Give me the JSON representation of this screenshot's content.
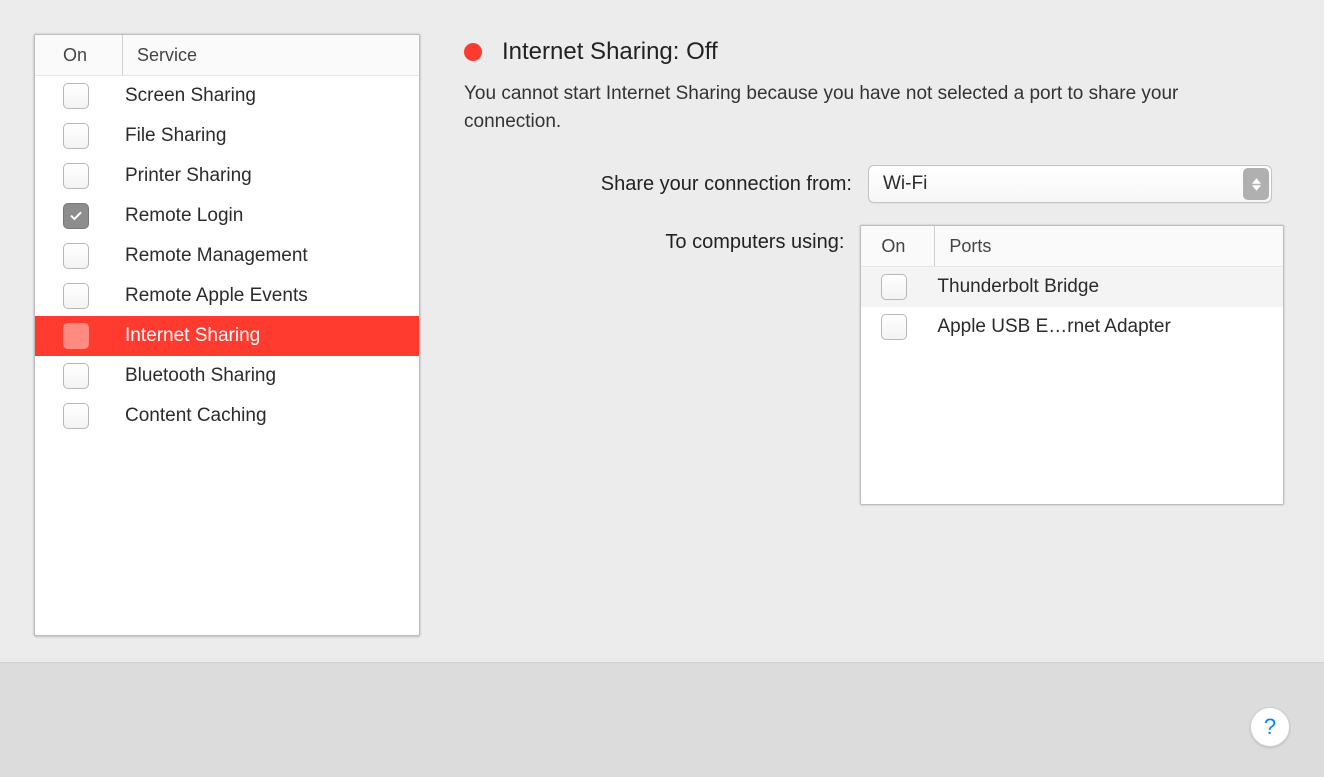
{
  "service_list": {
    "header": {
      "on": "On",
      "service": "Service"
    },
    "items": [
      {
        "label": "Screen Sharing",
        "checked": false,
        "selected": false
      },
      {
        "label": "File Sharing",
        "checked": false,
        "selected": false
      },
      {
        "label": "Printer Sharing",
        "checked": false,
        "selected": false
      },
      {
        "label": "Remote Login",
        "checked": true,
        "selected": false
      },
      {
        "label": "Remote Management",
        "checked": false,
        "selected": false
      },
      {
        "label": "Remote Apple Events",
        "checked": false,
        "selected": false
      },
      {
        "label": "Internet Sharing",
        "checked": false,
        "selected": true
      },
      {
        "label": "Bluetooth Sharing",
        "checked": false,
        "selected": false
      },
      {
        "label": "Content Caching",
        "checked": false,
        "selected": false
      }
    ]
  },
  "status": {
    "color": "#ff3b30",
    "title": "Internet Sharing: Off",
    "description": "You cannot start Internet Sharing because you have not selected a port to share your connection."
  },
  "share_from": {
    "label": "Share your connection from:",
    "value": "Wi-Fi"
  },
  "to_computers": {
    "label": "To computers using:",
    "header": {
      "on": "On",
      "ports": "Ports"
    },
    "ports": [
      {
        "label": "Thunderbolt Bridge",
        "checked": false
      },
      {
        "label": "Apple USB E…rnet Adapter",
        "checked": false
      }
    ]
  },
  "help": {
    "glyph": "?"
  }
}
